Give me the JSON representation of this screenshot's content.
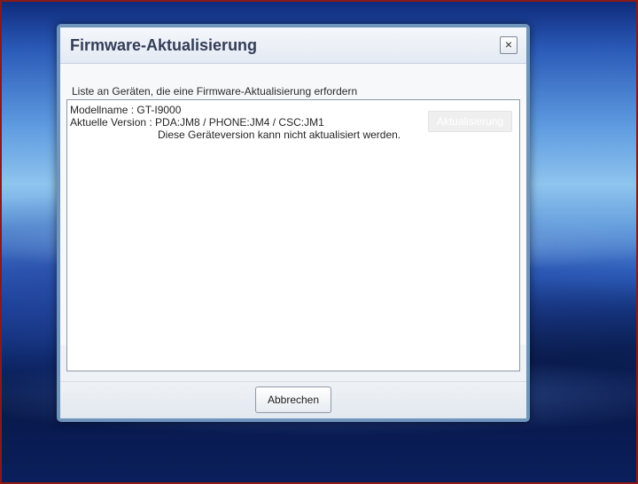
{
  "dialog": {
    "title": "Firmware-Aktualisierung",
    "close_icon": "×",
    "list_caption": "Liste an Geräten, die eine Firmware-Aktualisierung erfordern",
    "devices": [
      {
        "model_line": "Modellname : GT-I9000",
        "version_line": "Aktuelle Version : PDA:JM8 / PHONE:JM4 / CSC:JM1",
        "status_line": "Diese Geräteversion kann nicht aktualisiert werden.",
        "update_label": "Aktualisierung"
      }
    ],
    "cancel_label": "Abbrechen"
  },
  "icons": {
    "close": "close-icon"
  },
  "colors": {
    "dialog_border": "#6f95bd",
    "title_text": "#333d57",
    "desktop_top": "#0f2b7c",
    "desktop_bottom": "#0a1f5c",
    "screen_border": "#8a1a1a"
  }
}
